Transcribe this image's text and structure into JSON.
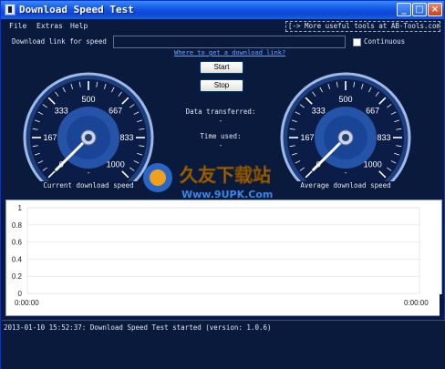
{
  "window": {
    "title": "Download Speed Test"
  },
  "titlebar_buttons": {
    "minimize": "_",
    "maximize": "□",
    "close": "×"
  },
  "menu": {
    "file": "File",
    "extras": "Extras",
    "help": "Help"
  },
  "promo_link": "[-> More useful tools at AB-Tools.com <-]",
  "form": {
    "url_label": "Download link for speed",
    "url_value": "",
    "continuous_label": "Continuous",
    "continuous_checked": false,
    "help_link": "Where to get a download link?"
  },
  "buttons": {
    "start": "Start",
    "stop": "Stop"
  },
  "stats": {
    "data_label": "Data transferred:",
    "data_value": "-",
    "time_label": "Time used:",
    "time_value": "-"
  },
  "gauges": {
    "ticks": [
      "0",
      "167",
      "333",
      "500",
      "667",
      "833",
      "1000"
    ],
    "current": {
      "caption": "Current download speed",
      "value_text": "-",
      "needle_value": 0
    },
    "average": {
      "caption": "Average download speed",
      "value_text": "-",
      "needle_value": 0
    }
  },
  "watermark": {
    "line1": "久友下载站",
    "line2": "Www.9UPK.Com"
  },
  "chart_data": {
    "type": "line",
    "y_ticks": [
      "1",
      "0.8",
      "0.6",
      "0.4",
      "0.2",
      "0"
    ],
    "ylim": [
      0,
      1
    ],
    "x_start": "0:00:00",
    "x_end": "0:00:00",
    "series": []
  },
  "log": {
    "lines": [
      "2013-01-10 15:52:37: Download Speed Test started (version: 1.0.6)"
    ]
  }
}
